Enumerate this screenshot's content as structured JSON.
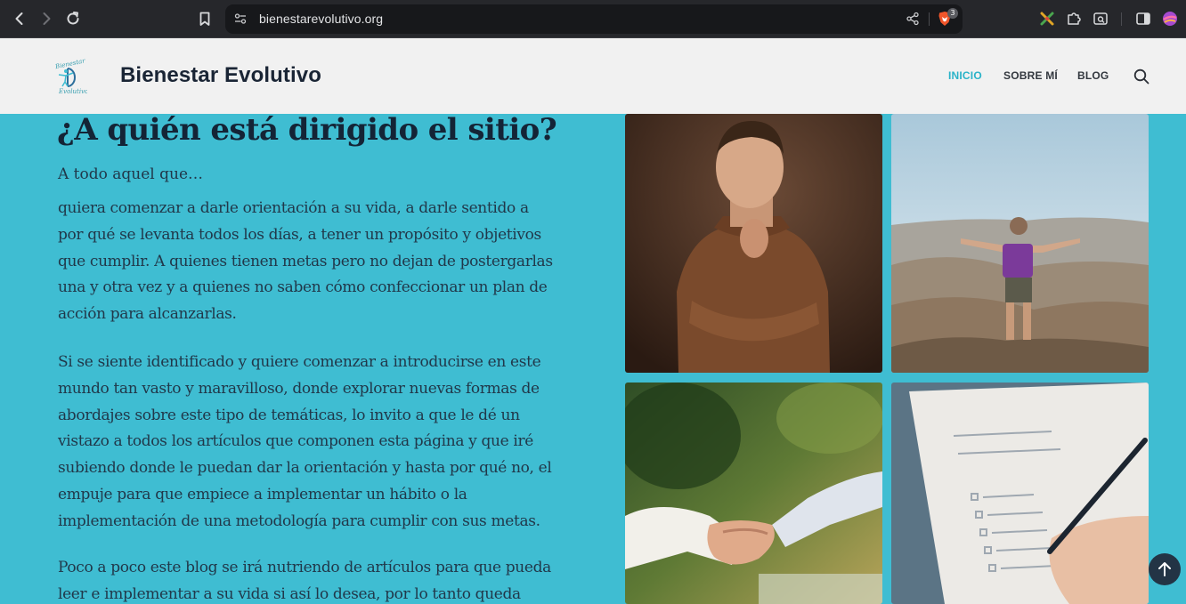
{
  "browser": {
    "url": "bienestarevolutivo.org",
    "shield_count": "3"
  },
  "site": {
    "title": "Bienestar Evolutivo",
    "logo_text": [
      "Bienestar",
      "Evolutivo"
    ],
    "menu": [
      {
        "label": "INICIO",
        "active": true
      },
      {
        "label": "SOBRE MÍ",
        "active": false
      },
      {
        "label": "BLOG",
        "active": false
      }
    ]
  },
  "content": {
    "heading": "¿A quién está dirigido el sitio?",
    "intro": "A todo aquel que…",
    "paragraph1": [
      "quiera comenzar a darle orientación a su vida, a darle sentido a",
      "por qué se levanta todos los días, a tener un propósito y objetivos",
      "que cumplir. A quienes tienen metas pero no dejan de postergarlas",
      "una y otra vez y a quienes no saben cómo confeccionar un plan de",
      "acción para alcanzarlas."
    ],
    "paragraph2": [
      "Si se siente identificado y quiere comenzar a introducirse en este",
      "mundo tan vasto y maravilloso, donde explorar nuevas formas de",
      "abordajes sobre este tipo de temáticas, lo invito a que le dé un",
      "vistazo a todos los artículos que componen esta página y que iré",
      "subiendo donde le puedan dar la orientación y hasta por qué no, el",
      "empuje para que empiece a implementar un hábito o la",
      "implementación de una metodología para cumplir con sus metas."
    ],
    "paragraph3": [
      "Poco a poco este blog se irá nutriendo de artículos para que pueda",
      "leer e implementar a su vida si así lo desea, por lo tanto queda"
    ]
  },
  "colors": {
    "page_bg": "#3fbdd2",
    "header_bg": "#f1f1f1",
    "accent": "#2ab3c8",
    "heading": "#142436",
    "body_text": "#21384a"
  },
  "icons": [
    "back-icon",
    "forward-icon",
    "reload-icon",
    "bookmark-icon",
    "site-settings-icon",
    "share-icon",
    "brave-shield-icon",
    "extension-icon",
    "puzzle-icon",
    "reader-icon",
    "sidebar-icon",
    "profile-icon",
    "search-icon",
    "arrow-up-icon"
  ]
}
